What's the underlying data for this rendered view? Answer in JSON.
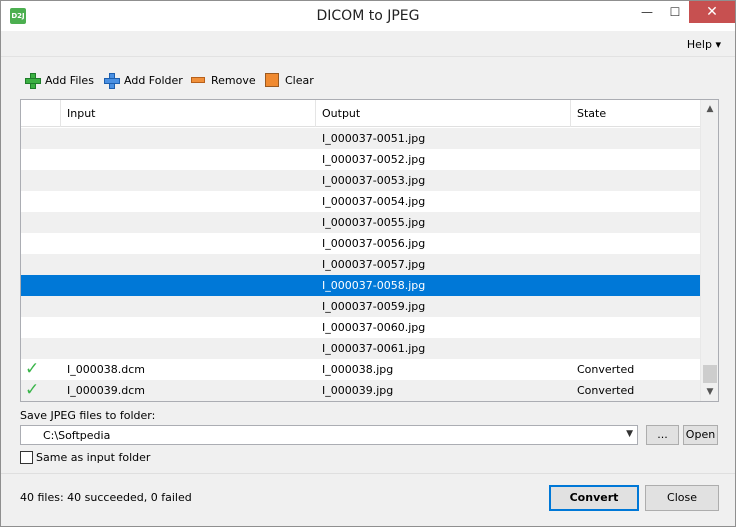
{
  "window": {
    "title": "DICOM to JPEG",
    "app_icon_text": "D2J",
    "minimize": "—",
    "maximize": "☐",
    "close": "✕"
  },
  "menu": {
    "help_label": "Help ▾"
  },
  "toolbar": {
    "add_files": "Add Files",
    "add_folder": "Add Folder",
    "remove": "Remove",
    "clear": "Clear"
  },
  "grid": {
    "columns": [
      "Input",
      "Output",
      "State"
    ],
    "rows": [
      {
        "status_icon": "",
        "input": "",
        "output": "I_000037-0051.jpg",
        "state": ""
      },
      {
        "status_icon": "",
        "input": "",
        "output": "I_000037-0052.jpg",
        "state": ""
      },
      {
        "status_icon": "",
        "input": "",
        "output": "I_000037-0053.jpg",
        "state": ""
      },
      {
        "status_icon": "",
        "input": "",
        "output": "I_000037-0054.jpg",
        "state": ""
      },
      {
        "status_icon": "",
        "input": "",
        "output": "I_000037-0055.jpg",
        "state": ""
      },
      {
        "status_icon": "",
        "input": "",
        "output": "I_000037-0056.jpg",
        "state": ""
      },
      {
        "status_icon": "",
        "input": "",
        "output": "I_000037-0057.jpg",
        "state": ""
      },
      {
        "status_icon": "",
        "input": "",
        "output": "I_000037-0058.jpg",
        "state": ""
      },
      {
        "status_icon": "",
        "input": "",
        "output": "I_000037-0059.jpg",
        "state": ""
      },
      {
        "status_icon": "",
        "input": "",
        "output": "I_000037-0060.jpg",
        "state": ""
      },
      {
        "status_icon": "",
        "input": "",
        "output": "I_000037-0061.jpg",
        "state": ""
      },
      {
        "status_icon": "✓",
        "input": "I_000038.dcm",
        "output": "I_000038.jpg",
        "state": "Converted"
      },
      {
        "status_icon": "✓",
        "input": "I_000039.dcm",
        "output": "I_000039.jpg",
        "state": "Converted"
      }
    ]
  },
  "save": {
    "label": "Save JPEG files to folder:",
    "folder_value": "C:\\Softpedia",
    "browse_label": "...",
    "open_label": "Open",
    "same_as_input_label": "Same as input folder"
  },
  "status": {
    "summary": "40 files: 40 succeeded, 0 failed",
    "convert_label": "Convert",
    "close_label": "Close"
  },
  "colors": {
    "selection": "#0078d7",
    "check": "#3ab54a",
    "close_button": "#c75050"
  }
}
